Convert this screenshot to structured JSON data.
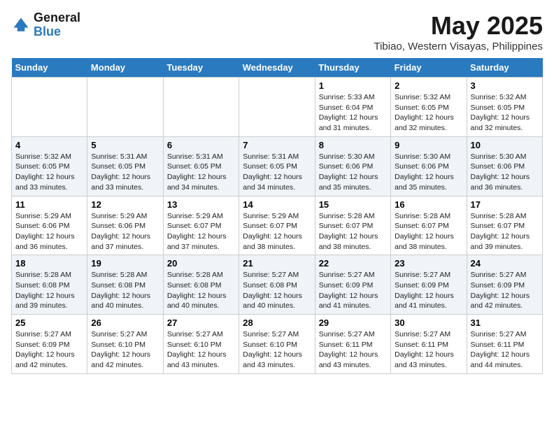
{
  "header": {
    "logo_general": "General",
    "logo_blue": "Blue",
    "month": "May 2025",
    "location": "Tibiao, Western Visayas, Philippines"
  },
  "days_of_week": [
    "Sunday",
    "Monday",
    "Tuesday",
    "Wednesday",
    "Thursday",
    "Friday",
    "Saturday"
  ],
  "weeks": [
    [
      {
        "day": "",
        "info": ""
      },
      {
        "day": "",
        "info": ""
      },
      {
        "day": "",
        "info": ""
      },
      {
        "day": "",
        "info": ""
      },
      {
        "day": "1",
        "info": "Sunrise: 5:33 AM\nSunset: 6:04 PM\nDaylight: 12 hours\nand 31 minutes."
      },
      {
        "day": "2",
        "info": "Sunrise: 5:32 AM\nSunset: 6:05 PM\nDaylight: 12 hours\nand 32 minutes."
      },
      {
        "day": "3",
        "info": "Sunrise: 5:32 AM\nSunset: 6:05 PM\nDaylight: 12 hours\nand 32 minutes."
      }
    ],
    [
      {
        "day": "4",
        "info": "Sunrise: 5:32 AM\nSunset: 6:05 PM\nDaylight: 12 hours\nand 33 minutes."
      },
      {
        "day": "5",
        "info": "Sunrise: 5:31 AM\nSunset: 6:05 PM\nDaylight: 12 hours\nand 33 minutes."
      },
      {
        "day": "6",
        "info": "Sunrise: 5:31 AM\nSunset: 6:05 PM\nDaylight: 12 hours\nand 34 minutes."
      },
      {
        "day": "7",
        "info": "Sunrise: 5:31 AM\nSunset: 6:05 PM\nDaylight: 12 hours\nand 34 minutes."
      },
      {
        "day": "8",
        "info": "Sunrise: 5:30 AM\nSunset: 6:06 PM\nDaylight: 12 hours\nand 35 minutes."
      },
      {
        "day": "9",
        "info": "Sunrise: 5:30 AM\nSunset: 6:06 PM\nDaylight: 12 hours\nand 35 minutes."
      },
      {
        "day": "10",
        "info": "Sunrise: 5:30 AM\nSunset: 6:06 PM\nDaylight: 12 hours\nand 36 minutes."
      }
    ],
    [
      {
        "day": "11",
        "info": "Sunrise: 5:29 AM\nSunset: 6:06 PM\nDaylight: 12 hours\nand 36 minutes."
      },
      {
        "day": "12",
        "info": "Sunrise: 5:29 AM\nSunset: 6:06 PM\nDaylight: 12 hours\nand 37 minutes."
      },
      {
        "day": "13",
        "info": "Sunrise: 5:29 AM\nSunset: 6:07 PM\nDaylight: 12 hours\nand 37 minutes."
      },
      {
        "day": "14",
        "info": "Sunrise: 5:29 AM\nSunset: 6:07 PM\nDaylight: 12 hours\nand 38 minutes."
      },
      {
        "day": "15",
        "info": "Sunrise: 5:28 AM\nSunset: 6:07 PM\nDaylight: 12 hours\nand 38 minutes."
      },
      {
        "day": "16",
        "info": "Sunrise: 5:28 AM\nSunset: 6:07 PM\nDaylight: 12 hours\nand 38 minutes."
      },
      {
        "day": "17",
        "info": "Sunrise: 5:28 AM\nSunset: 6:07 PM\nDaylight: 12 hours\nand 39 minutes."
      }
    ],
    [
      {
        "day": "18",
        "info": "Sunrise: 5:28 AM\nSunset: 6:08 PM\nDaylight: 12 hours\nand 39 minutes."
      },
      {
        "day": "19",
        "info": "Sunrise: 5:28 AM\nSunset: 6:08 PM\nDaylight: 12 hours\nand 40 minutes."
      },
      {
        "day": "20",
        "info": "Sunrise: 5:28 AM\nSunset: 6:08 PM\nDaylight: 12 hours\nand 40 minutes."
      },
      {
        "day": "21",
        "info": "Sunrise: 5:27 AM\nSunset: 6:08 PM\nDaylight: 12 hours\nand 40 minutes."
      },
      {
        "day": "22",
        "info": "Sunrise: 5:27 AM\nSunset: 6:09 PM\nDaylight: 12 hours\nand 41 minutes."
      },
      {
        "day": "23",
        "info": "Sunrise: 5:27 AM\nSunset: 6:09 PM\nDaylight: 12 hours\nand 41 minutes."
      },
      {
        "day": "24",
        "info": "Sunrise: 5:27 AM\nSunset: 6:09 PM\nDaylight: 12 hours\nand 42 minutes."
      }
    ],
    [
      {
        "day": "25",
        "info": "Sunrise: 5:27 AM\nSunset: 6:09 PM\nDaylight: 12 hours\nand 42 minutes."
      },
      {
        "day": "26",
        "info": "Sunrise: 5:27 AM\nSunset: 6:10 PM\nDaylight: 12 hours\nand 42 minutes."
      },
      {
        "day": "27",
        "info": "Sunrise: 5:27 AM\nSunset: 6:10 PM\nDaylight: 12 hours\nand 43 minutes."
      },
      {
        "day": "28",
        "info": "Sunrise: 5:27 AM\nSunset: 6:10 PM\nDaylight: 12 hours\nand 43 minutes."
      },
      {
        "day": "29",
        "info": "Sunrise: 5:27 AM\nSunset: 6:11 PM\nDaylight: 12 hours\nand 43 minutes."
      },
      {
        "day": "30",
        "info": "Sunrise: 5:27 AM\nSunset: 6:11 PM\nDaylight: 12 hours\nand 43 minutes."
      },
      {
        "day": "31",
        "info": "Sunrise: 5:27 AM\nSunset: 6:11 PM\nDaylight: 12 hours\nand 44 minutes."
      }
    ]
  ]
}
